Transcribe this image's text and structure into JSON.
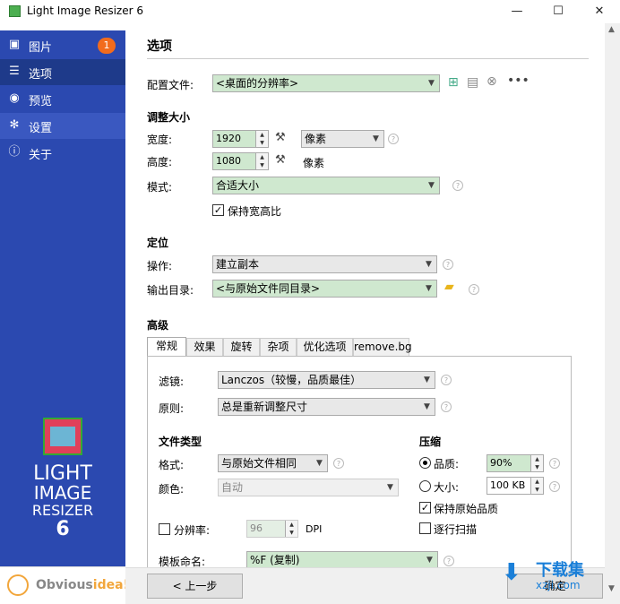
{
  "window": {
    "title": "Light Image Resizer 6",
    "minimize": "—",
    "maximize": "☐",
    "close": "✕"
  },
  "sidebar": {
    "items": [
      {
        "label": "图片",
        "icon": "images-icon",
        "badge": "1"
      },
      {
        "label": "选项",
        "icon": "sliders-icon"
      },
      {
        "label": "预览",
        "icon": "eye-icon"
      },
      {
        "label": "设置",
        "icon": "gear-icon"
      },
      {
        "label": "关于",
        "icon": "info-icon"
      }
    ],
    "logo": {
      "line1": "LIGHT",
      "line2": "IMAGE",
      "line3": "RESIZER",
      "line4": "6"
    },
    "vendor": {
      "part1": "Obvious",
      "part2": "idea!"
    }
  },
  "main": {
    "title": "选项",
    "profile": {
      "label": "配置文件:",
      "value": "<桌面的分辨率>"
    },
    "resize": {
      "header": "调整大小",
      "width_label": "宽度:",
      "width": "1920",
      "height_label": "高度:",
      "height": "1080",
      "unit": "像素",
      "unit2": "像素",
      "mode_label": "模式:",
      "mode": "合适大小",
      "keep_ratio": "保持宽高比"
    },
    "target": {
      "header": "定位",
      "action_label": "操作:",
      "action": "建立副本",
      "output_label": "输出目录:",
      "output": "<与原始文件同目录>"
    },
    "advanced": {
      "header": "高级",
      "tabs": [
        "常规",
        "效果",
        "旋转",
        "杂项",
        "优化选项",
        "remove.bg"
      ],
      "filter_label": "滤镜:",
      "filter": "Lanczos（较慢，品质最佳）",
      "rule_label": "原则:",
      "rule": "总是重新调整尺寸",
      "filetype_header": "文件类型",
      "format_label": "格式:",
      "format": "与原始文件相同",
      "color_label": "颜色:",
      "color": "自动",
      "dpi_check": "分辨率:",
      "dpi_value": "96",
      "dpi_unit": "DPI",
      "template_label": "模板命名:",
      "template": "%F (复制)",
      "compress_header": "压缩",
      "quality_label": "品质:",
      "quality": "90%",
      "size_label": "大小:",
      "size": "100 KB",
      "keep_quality": "保持原始品质",
      "progressive": "逐行扫描"
    },
    "buttons": {
      "back": "< 上一步",
      "next": "确定"
    }
  },
  "watermark": {
    "brand": "下载集",
    "url": "xzji.com"
  }
}
